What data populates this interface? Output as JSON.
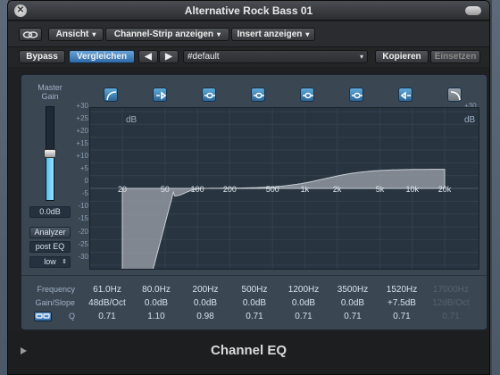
{
  "window": {
    "title": "Alternative Rock Bass 01"
  },
  "toolbar": {
    "link_icon": "link-icon",
    "ansicht_label": "Ansicht",
    "channel_strip_label": "Channel-Strip anzeigen",
    "insert_label": "Insert anzeigen",
    "bypass_label": "Bypass",
    "compare_label": "Vergleichen",
    "preset_value": "#default",
    "copy_label": "Kopieren",
    "paste_label": "Einsetzen"
  },
  "eq": {
    "master_gain_label_1": "Master",
    "master_gain_label_2": "Gain",
    "gain_value": "0.0dB",
    "gain_level": 0.5,
    "analyzer_label": "Analyzer",
    "analyzer_mode": "post EQ",
    "resolution": "low",
    "band_icons": [
      "low-cut-icon",
      "low-shelf-icon",
      "peak-band-icon",
      "peak-band-icon",
      "peak-band-icon",
      "peak-band-icon",
      "high-shelf-icon",
      "high-cut-icon"
    ],
    "db_label_left": "dB",
    "db_label_right": "dB",
    "db_scale": [
      "+30",
      "+25",
      "+20",
      "+15",
      "+10",
      "+5",
      "0",
      "-5",
      "-10",
      "-15",
      "-20",
      "-25",
      "-30"
    ],
    "freq_labels": [
      "20",
      "50",
      "100",
      "200",
      "500",
      "1k",
      "2k",
      "5k",
      "10k",
      "20k"
    ],
    "row_labels": {
      "frequency": "Frequency",
      "gain_slope": "Gain/Slope",
      "q": "Q"
    },
    "bands": [
      {
        "freq": "61.0Hz",
        "gain": "48dB/Oct",
        "q": "0.71",
        "active": true
      },
      {
        "freq": "80.0Hz",
        "gain": "0.0dB",
        "q": "1.10",
        "active": true
      },
      {
        "freq": "200Hz",
        "gain": "0.0dB",
        "q": "0.98",
        "active": true
      },
      {
        "freq": "500Hz",
        "gain": "0.0dB",
        "q": "0.71",
        "active": true
      },
      {
        "freq": "1200Hz",
        "gain": "0.0dB",
        "q": "0.71",
        "active": true
      },
      {
        "freq": "3500Hz",
        "gain": "0.0dB",
        "q": "0.71",
        "active": true
      },
      {
        "freq": "1520Hz",
        "gain": "+7.5dB",
        "q": "0.71",
        "active": true
      },
      {
        "freq": "17000Hz",
        "gain": "12dB/Oct",
        "q": "0.71",
        "active": false
      }
    ]
  },
  "footer": {
    "plugin_name": "Channel EQ"
  },
  "colors": {
    "accent": "#4aa3de",
    "curve_fill": "#8f97a0",
    "graph_bg": "#283440"
  }
}
